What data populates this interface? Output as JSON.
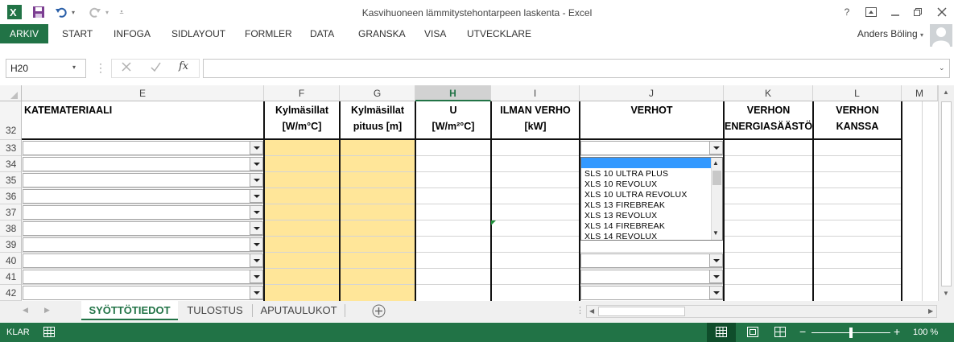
{
  "window": {
    "title": "Kasvihuoneen lämmitystehontarpeen laskenta - Excel",
    "help": "?"
  },
  "ribbon": {
    "tabs": [
      "ARKIV",
      "START",
      "INFOGA",
      "SIDLAYOUT",
      "FORMLER",
      "DATA",
      "GRANSKA",
      "VISA",
      "UTVECKLARE"
    ],
    "account": "Anders Böling"
  },
  "formula_bar": {
    "name_box": "H20",
    "fx": "fx",
    "value": ""
  },
  "columns": [
    "E",
    "F",
    "G",
    "H",
    "I",
    "J",
    "K",
    "L",
    "M"
  ],
  "rows": [
    "32",
    "33",
    "34",
    "35",
    "36",
    "37",
    "38",
    "39",
    "40",
    "41",
    "42"
  ],
  "headers": {
    "E": [
      "KATEMATERIAALI"
    ],
    "F": [
      "Kylmäsillat",
      "[W/m°C]"
    ],
    "G": [
      "Kylmäsillat",
      "pituus [m]"
    ],
    "H": [
      "U",
      "[W/m²°C]"
    ],
    "I": [
      "ILMAN VERHO",
      "[kW]"
    ],
    "J": [
      "VERHOT"
    ],
    "K": [
      "VERHON",
      "ENERGIASÄÄSTÖ"
    ],
    "L": [
      "VERHON",
      "KANSSA"
    ]
  },
  "dropdown_options": [
    "",
    "SLS 10 ULTRA PLUS",
    "XLS 10 REVOLUX",
    "XLS 10 ULTRA REVOLUX",
    "XLS 13 FIREBREAK",
    "XLS 13 REVOLUX",
    "XLS 14 FIREBREAK",
    "XLS 14 REVOLUX"
  ],
  "sheets": [
    "SYÖTTÖTIEDOT",
    "TULOSTUS",
    "APUTAULUKOT"
  ],
  "status": {
    "mode": "KLAR",
    "zoom": "100 %"
  },
  "colors": {
    "accent": "#217346",
    "input_fill": "#ffe699",
    "selection": "#3399ff"
  }
}
